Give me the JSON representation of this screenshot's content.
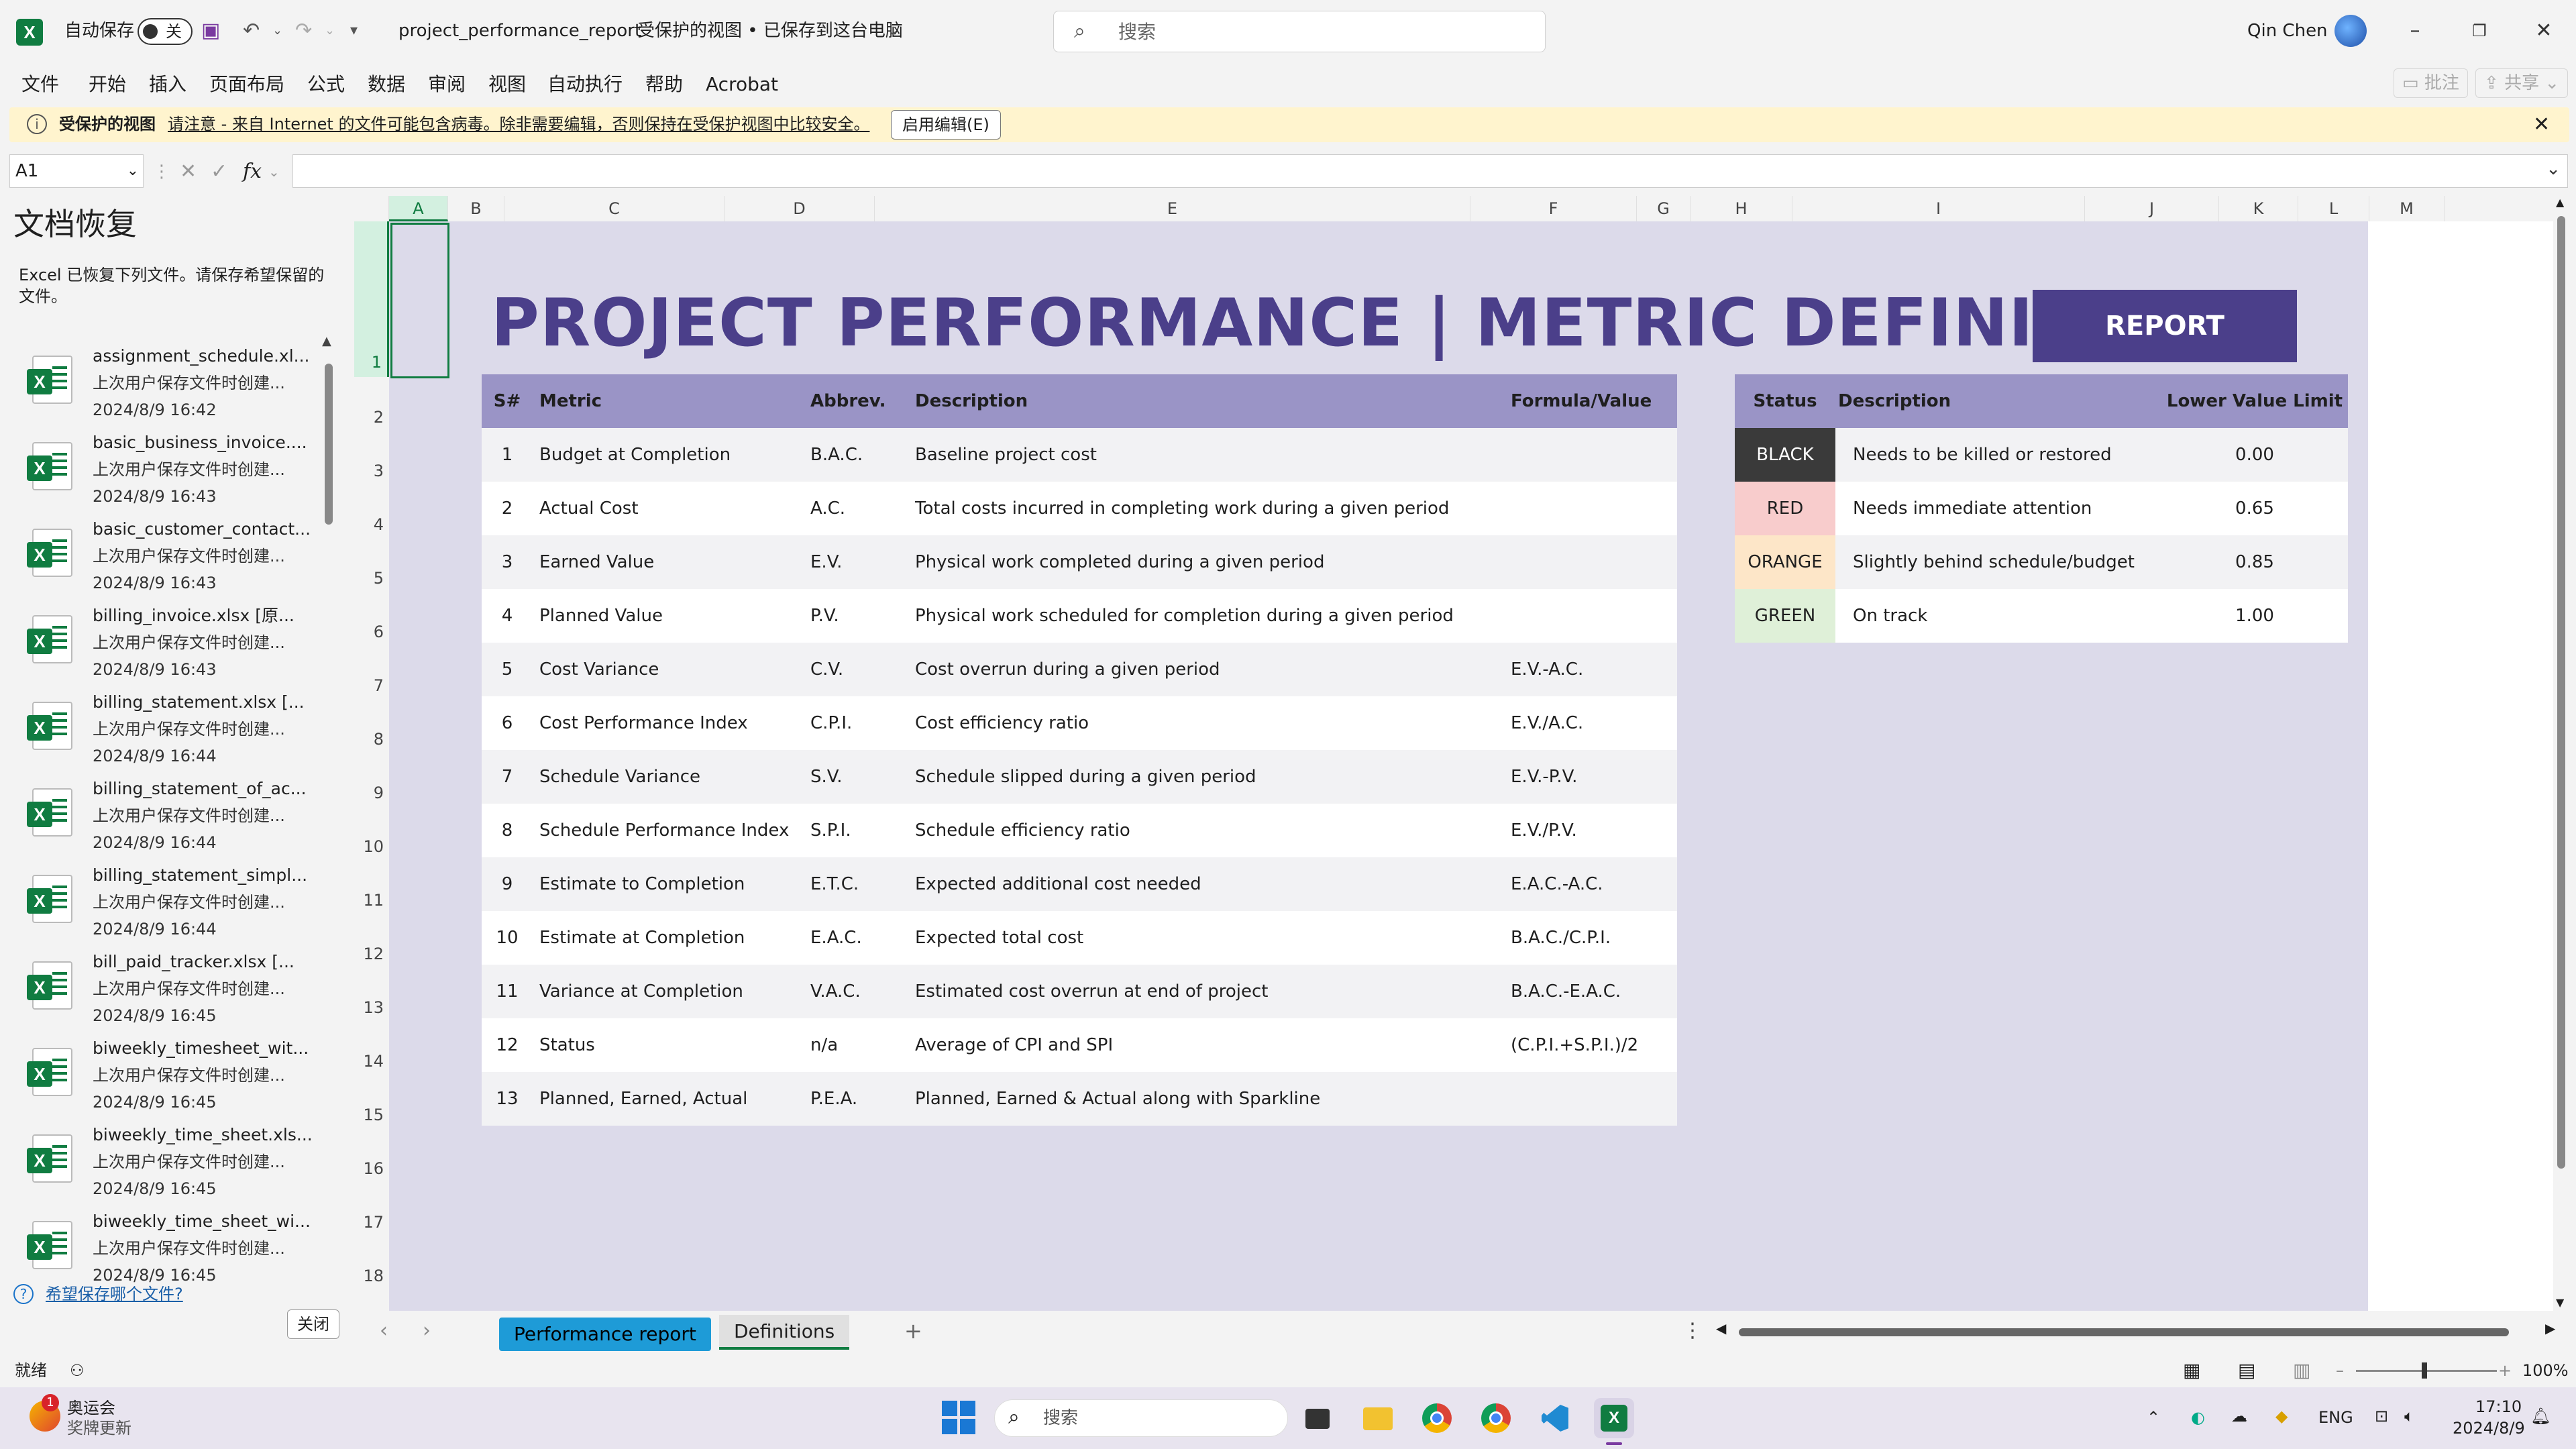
{
  "titlebar": {
    "autosave_label": "自动保存",
    "autosave_state": "关",
    "filename": "project_performance_report",
    "file_state": "受保护的视图 • 已保存到这台电脑",
    "search_placeholder": "搜索",
    "user_name": "Qin Chen"
  },
  "menu": {
    "items": [
      "文件",
      "开始",
      "插入",
      "页面布局",
      "公式",
      "数据",
      "审阅",
      "视图",
      "自动执行",
      "帮助",
      "Acrobat"
    ],
    "comments_label": "批注",
    "share_label": "共享"
  },
  "protected_bar": {
    "title": "受保护的视图",
    "message": "请注意 - 来自 Internet 的文件可能包含病毒。除非需要编辑，否则保持在受保护视图中比较安全。",
    "enable_button": "启用编辑(E)"
  },
  "formula_bar": {
    "cell_ref": "A1",
    "fx": "fx",
    "value": ""
  },
  "recovery": {
    "title": "文档恢复",
    "description": "Excel 已恢复下列文件。请保存希望保留的文件。",
    "files": [
      {
        "name": "assignment_schedule.xl...",
        "status": "上次用户保存文件时创建...",
        "time": "2024/8/9 16:42"
      },
      {
        "name": "basic_business_invoice....",
        "status": "上次用户保存文件时创建...",
        "time": "2024/8/9 16:43"
      },
      {
        "name": "basic_customer_contact...",
        "status": "上次用户保存文件时创建...",
        "time": "2024/8/9 16:43"
      },
      {
        "name": "billing_invoice.xlsx [原...",
        "status": "上次用户保存文件时创建...",
        "time": "2024/8/9 16:43"
      },
      {
        "name": "billing_statement.xlsx [...",
        "status": "上次用户保存文件时创建...",
        "time": "2024/8/9 16:44"
      },
      {
        "name": "billing_statement_of_ac...",
        "status": "上次用户保存文件时创建...",
        "time": "2024/8/9 16:44"
      },
      {
        "name": "billing_statement_simpl...",
        "status": "上次用户保存文件时创建...",
        "time": "2024/8/9 16:44"
      },
      {
        "name": "bill_paid_tracker.xlsx [...",
        "status": "上次用户保存文件时创建...",
        "time": "2024/8/9 16:45"
      },
      {
        "name": "biweekly_timesheet_wit...",
        "status": "上次用户保存文件时创建...",
        "time": "2024/8/9 16:45"
      },
      {
        "name": "biweekly_time_sheet.xls...",
        "status": "上次用户保存文件时创建...",
        "time": "2024/8/9 16:45"
      },
      {
        "name": "biweekly_time_sheet_wi...",
        "status": "上次用户保存文件时创建...",
        "time": "2024/8/9 16:45"
      }
    ],
    "question_link": "希望保存哪个文件?",
    "close_button": "关闭"
  },
  "columns": [
    "A",
    "B",
    "C",
    "D",
    "E",
    "F",
    "G",
    "H",
    "I",
    "J",
    "K",
    "L",
    "M"
  ],
  "rows": [
    "1",
    "2",
    "3",
    "4",
    "5",
    "6",
    "7",
    "8",
    "9",
    "10",
    "11",
    "12",
    "13",
    "14",
    "15",
    "16",
    "17",
    "18"
  ],
  "sheet": {
    "title": "PROJECT PERFORMANCE  |  METRIC DEFINITIONS",
    "report_button": "REPORT",
    "metrics_headers": [
      "S#",
      "Metric",
      "Abbrev.",
      "Description",
      "Formula/Value"
    ],
    "metrics": [
      {
        "n": "1",
        "metric": "Budget at Completion",
        "abbrev": "B.A.C.",
        "desc": "Baseline project cost",
        "formula": ""
      },
      {
        "n": "2",
        "metric": "Actual Cost",
        "abbrev": "A.C.",
        "desc": "Total costs incurred in completing work during a given period",
        "formula": ""
      },
      {
        "n": "3",
        "metric": "Earned Value",
        "abbrev": "E.V.",
        "desc": "Physical work completed during a given period",
        "formula": ""
      },
      {
        "n": "4",
        "metric": "Planned Value",
        "abbrev": "P.V.",
        "desc": "Physical work scheduled for completion during a given period",
        "formula": ""
      },
      {
        "n": "5",
        "metric": "Cost Variance",
        "abbrev": "C.V.",
        "desc": "Cost overrun during a given period",
        "formula": "E.V.-A.C."
      },
      {
        "n": "6",
        "metric": "Cost Performance Index",
        "abbrev": "C.P.I.",
        "desc": "Cost efficiency ratio",
        "formula": "E.V./A.C."
      },
      {
        "n": "7",
        "metric": "Schedule Variance",
        "abbrev": "S.V.",
        "desc": "Schedule slipped during a given period",
        "formula": "E.V.-P.V."
      },
      {
        "n": "8",
        "metric": "Schedule Performance Index",
        "abbrev": "S.P.I.",
        "desc": "Schedule efficiency ratio",
        "formula": "E.V./P.V."
      },
      {
        "n": "9",
        "metric": "Estimate to Completion",
        "abbrev": "E.T.C.",
        "desc": "Expected additional cost needed",
        "formula": "E.A.C.-A.C."
      },
      {
        "n": "10",
        "metric": "Estimate at Completion",
        "abbrev": "E.A.C.",
        "desc": "Expected total cost",
        "formula": "B.A.C./C.P.I."
      },
      {
        "n": "11",
        "metric": "Variance at Completion",
        "abbrev": "V.A.C.",
        "desc": "Estimated cost overrun at end of project",
        "formula": "B.A.C.-E.A.C."
      },
      {
        "n": "12",
        "metric": "Status",
        "abbrev": "n/a",
        "desc": "Average of CPI and SPI",
        "formula": "(C.P.I.+S.P.I.)/2"
      },
      {
        "n": "13",
        "metric": "Planned, Earned, Actual",
        "abbrev": "P.E.A.",
        "desc": "Planned, Earned & Actual along with Sparkline",
        "formula": ""
      }
    ],
    "status_headers": [
      "Status",
      "Description",
      "Lower Value Limit"
    ],
    "statuses": [
      {
        "status": "BLACK",
        "desc": "Needs to be killed or restored",
        "limit": "0.00",
        "bg": "#3a3a3a",
        "fg": "#ffffff"
      },
      {
        "status": "RED",
        "desc": "Needs immediate attention",
        "limit": "0.65",
        "bg": "#f8cccc",
        "fg": "#1f1f1f"
      },
      {
        "status": "ORANGE",
        "desc": "Slightly behind schedule/budget",
        "limit": "0.85",
        "bg": "#fde6c8",
        "fg": "#1f1f1f"
      },
      {
        "status": "GREEN",
        "desc": "On track",
        "limit": "1.00",
        "bg": "#dff0d8",
        "fg": "#1f1f1f"
      }
    ]
  },
  "tabs": {
    "tab1": "Performance report",
    "tab2": "Definitions"
  },
  "statusbar": {
    "ready": "就绪",
    "zoom": "100%"
  },
  "taskbar": {
    "news_title": "奥运会",
    "news_sub": "奖牌更新",
    "badge": "1",
    "search_placeholder": "搜索",
    "lang": "ENG",
    "time": "17:10",
    "date": "2024/8/9"
  },
  "colors": {
    "accent": "#4b3f8a",
    "header_band": "#9a94c6",
    "sheet_bg": "#dcdaea",
    "excel_green": "#107c41",
    "tab_active": "#1e9bd7"
  }
}
